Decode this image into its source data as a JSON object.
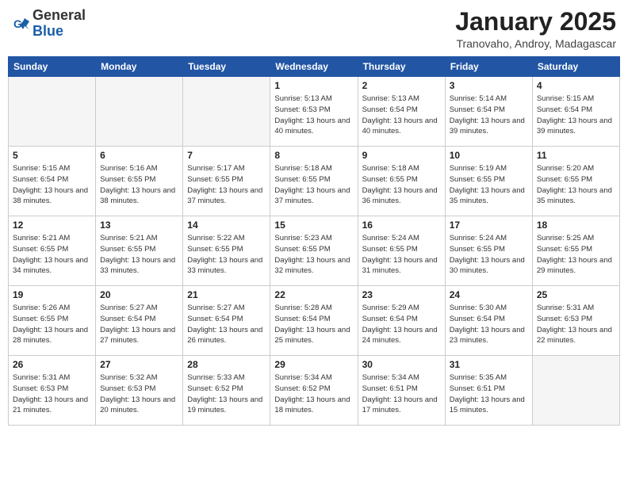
{
  "header": {
    "logo_general": "General",
    "logo_blue": "Blue",
    "title": "January 2025",
    "subtitle": "Tranovaho, Androy, Madagascar"
  },
  "days_of_week": [
    "Sunday",
    "Monday",
    "Tuesday",
    "Wednesday",
    "Thursday",
    "Friday",
    "Saturday"
  ],
  "weeks": [
    [
      {
        "day": "",
        "empty": true
      },
      {
        "day": "",
        "empty": true
      },
      {
        "day": "",
        "empty": true
      },
      {
        "day": "1",
        "sunrise": "5:13 AM",
        "sunset": "6:53 PM",
        "daylight": "13 hours and 40 minutes."
      },
      {
        "day": "2",
        "sunrise": "5:13 AM",
        "sunset": "6:54 PM",
        "daylight": "13 hours and 40 minutes."
      },
      {
        "day": "3",
        "sunrise": "5:14 AM",
        "sunset": "6:54 PM",
        "daylight": "13 hours and 39 minutes."
      },
      {
        "day": "4",
        "sunrise": "5:15 AM",
        "sunset": "6:54 PM",
        "daylight": "13 hours and 39 minutes."
      }
    ],
    [
      {
        "day": "5",
        "sunrise": "5:15 AM",
        "sunset": "6:54 PM",
        "daylight": "13 hours and 38 minutes."
      },
      {
        "day": "6",
        "sunrise": "5:16 AM",
        "sunset": "6:55 PM",
        "daylight": "13 hours and 38 minutes."
      },
      {
        "day": "7",
        "sunrise": "5:17 AM",
        "sunset": "6:55 PM",
        "daylight": "13 hours and 37 minutes."
      },
      {
        "day": "8",
        "sunrise": "5:18 AM",
        "sunset": "6:55 PM",
        "daylight": "13 hours and 37 minutes."
      },
      {
        "day": "9",
        "sunrise": "5:18 AM",
        "sunset": "6:55 PM",
        "daylight": "13 hours and 36 minutes."
      },
      {
        "day": "10",
        "sunrise": "5:19 AM",
        "sunset": "6:55 PM",
        "daylight": "13 hours and 35 minutes."
      },
      {
        "day": "11",
        "sunrise": "5:20 AM",
        "sunset": "6:55 PM",
        "daylight": "13 hours and 35 minutes."
      }
    ],
    [
      {
        "day": "12",
        "sunrise": "5:21 AM",
        "sunset": "6:55 PM",
        "daylight": "13 hours and 34 minutes."
      },
      {
        "day": "13",
        "sunrise": "5:21 AM",
        "sunset": "6:55 PM",
        "daylight": "13 hours and 33 minutes."
      },
      {
        "day": "14",
        "sunrise": "5:22 AM",
        "sunset": "6:55 PM",
        "daylight": "13 hours and 33 minutes."
      },
      {
        "day": "15",
        "sunrise": "5:23 AM",
        "sunset": "6:55 PM",
        "daylight": "13 hours and 32 minutes."
      },
      {
        "day": "16",
        "sunrise": "5:24 AM",
        "sunset": "6:55 PM",
        "daylight": "13 hours and 31 minutes."
      },
      {
        "day": "17",
        "sunrise": "5:24 AM",
        "sunset": "6:55 PM",
        "daylight": "13 hours and 30 minutes."
      },
      {
        "day": "18",
        "sunrise": "5:25 AM",
        "sunset": "6:55 PM",
        "daylight": "13 hours and 29 minutes."
      }
    ],
    [
      {
        "day": "19",
        "sunrise": "5:26 AM",
        "sunset": "6:55 PM",
        "daylight": "13 hours and 28 minutes."
      },
      {
        "day": "20",
        "sunrise": "5:27 AM",
        "sunset": "6:54 PM",
        "daylight": "13 hours and 27 minutes."
      },
      {
        "day": "21",
        "sunrise": "5:27 AM",
        "sunset": "6:54 PM",
        "daylight": "13 hours and 26 minutes."
      },
      {
        "day": "22",
        "sunrise": "5:28 AM",
        "sunset": "6:54 PM",
        "daylight": "13 hours and 25 minutes."
      },
      {
        "day": "23",
        "sunrise": "5:29 AM",
        "sunset": "6:54 PM",
        "daylight": "13 hours and 24 minutes."
      },
      {
        "day": "24",
        "sunrise": "5:30 AM",
        "sunset": "6:54 PM",
        "daylight": "13 hours and 23 minutes."
      },
      {
        "day": "25",
        "sunrise": "5:31 AM",
        "sunset": "6:53 PM",
        "daylight": "13 hours and 22 minutes."
      }
    ],
    [
      {
        "day": "26",
        "sunrise": "5:31 AM",
        "sunset": "6:53 PM",
        "daylight": "13 hours and 21 minutes."
      },
      {
        "day": "27",
        "sunrise": "5:32 AM",
        "sunset": "6:53 PM",
        "daylight": "13 hours and 20 minutes."
      },
      {
        "day": "28",
        "sunrise": "5:33 AM",
        "sunset": "6:52 PM",
        "daylight": "13 hours and 19 minutes."
      },
      {
        "day": "29",
        "sunrise": "5:34 AM",
        "sunset": "6:52 PM",
        "daylight": "13 hours and 18 minutes."
      },
      {
        "day": "30",
        "sunrise": "5:34 AM",
        "sunset": "6:51 PM",
        "daylight": "13 hours and 17 minutes."
      },
      {
        "day": "31",
        "sunrise": "5:35 AM",
        "sunset": "6:51 PM",
        "daylight": "13 hours and 15 minutes."
      },
      {
        "day": "",
        "empty": true
      }
    ]
  ],
  "labels": {
    "sunrise": "Sunrise:",
    "sunset": "Sunset:",
    "daylight": "Daylight:"
  }
}
